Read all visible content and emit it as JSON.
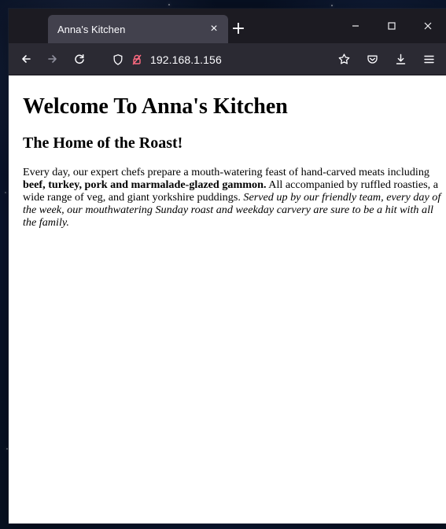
{
  "browser": {
    "tab_title": "Anna's Kitchen",
    "tab_close_glyph": "×",
    "new_tab_glyph": "+",
    "url": "192.168.1.156",
    "icons": {
      "back": "back-arrow-icon",
      "forward": "forward-arrow-icon",
      "reload": "reload-icon",
      "tracking_protection": "shield-icon",
      "connection": "lock-warning-icon",
      "bookmark": "star-icon",
      "pocket": "pocket-icon",
      "downloads": "download-icon",
      "menu": "hamburger-menu-icon",
      "minimize": "minimize-icon",
      "maximize": "maximize-icon",
      "close": "close-icon"
    },
    "colors": {
      "chrome_dark": "#1c1b22",
      "toolbar": "#2b2a33",
      "tab_active": "#42414d",
      "text_light": "#fbfbfe",
      "content_bg": "#ffffff",
      "warning_red": "#ff6b81"
    }
  },
  "page": {
    "heading": "Welcome To Anna's Kitchen",
    "subheading": "The Home of the Roast!",
    "paragraph": {
      "part1": "Every day, our expert chefs prepare a mouth-watering feast of hand-carved meats including ",
      "bold": "beef, turkey, pork and marmalade-glazed gammon.",
      "part2": " All accompanied by ruffled roasties, a wide range of veg, and giant yorkshire puddings. ",
      "italic": "Served up by our friendly team, every day of the week, our mouthwatering Sunday roast and weekday carvery are sure to be a hit with all the family."
    }
  }
}
